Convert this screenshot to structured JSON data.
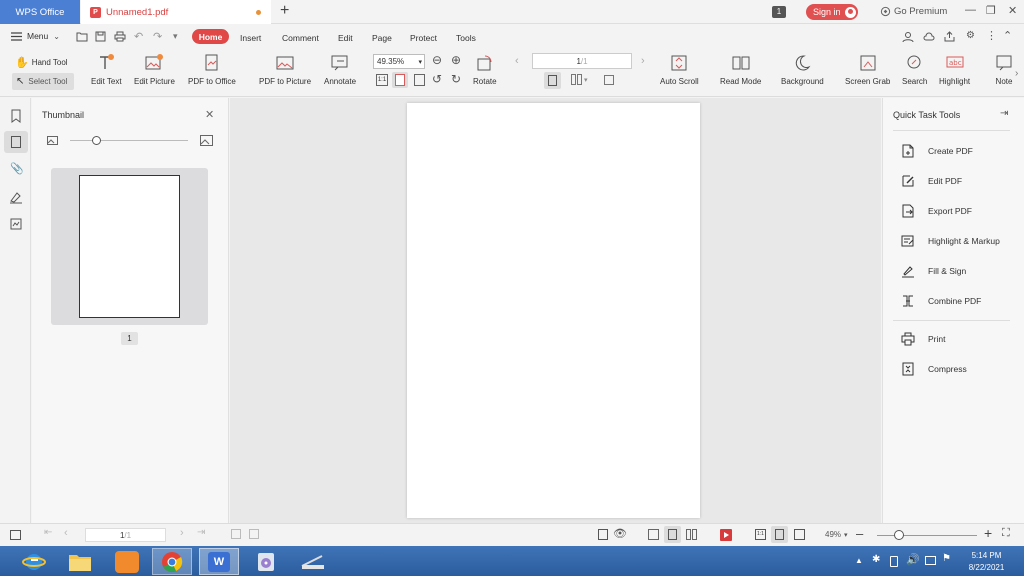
{
  "titlebar": {
    "app_tab": "WPS Office",
    "doc_tab": "Unnamed1.pdf",
    "pdf_badge": "P",
    "new_tab": "+",
    "notif_count": "1",
    "signin": "Sign in",
    "go_premium": "Go Premium"
  },
  "menu": {
    "menu_label": "Menu",
    "tabs": [
      "Home",
      "Insert",
      "Comment",
      "Edit",
      "Page",
      "Protect",
      "Tools"
    ]
  },
  "toolbar": {
    "hand_tool": "Hand Tool",
    "select_tool": "Select Tool",
    "edit_text": "Edit Text",
    "edit_picture": "Edit Picture",
    "pdf_to_office": "PDF to Office",
    "pdf_to_picture": "PDF to Picture",
    "annotate": "Annotate",
    "zoom": "49.35%",
    "rotate": "Rotate",
    "page_value": "1",
    "page_total": "/1",
    "auto_scroll": "Auto Scroll",
    "read_mode": "Read Mode",
    "background": "Background",
    "screen_grab": "Screen Grab",
    "search": "Search",
    "highlight": "Highlight",
    "note": "Note"
  },
  "thumbnail": {
    "title": "Thumbnail",
    "page_label": "1"
  },
  "quick_tools": {
    "title": "Quick Task Tools",
    "items": [
      "Create PDF",
      "Edit PDF",
      "Export PDF",
      "Highlight & Markup",
      "Fill & Sign",
      "Combine PDF"
    ],
    "items2": [
      "Print",
      "Compress"
    ]
  },
  "statusbar": {
    "page_value": "1",
    "page_total": "/1",
    "zoom": "49%"
  },
  "taskbar": {
    "time": "5:14 PM",
    "date": "8/22/2021"
  },
  "colors": {
    "accent": "#e04848",
    "app_tab": "#4a7fd4",
    "taskbar": "#2b5d9e"
  }
}
